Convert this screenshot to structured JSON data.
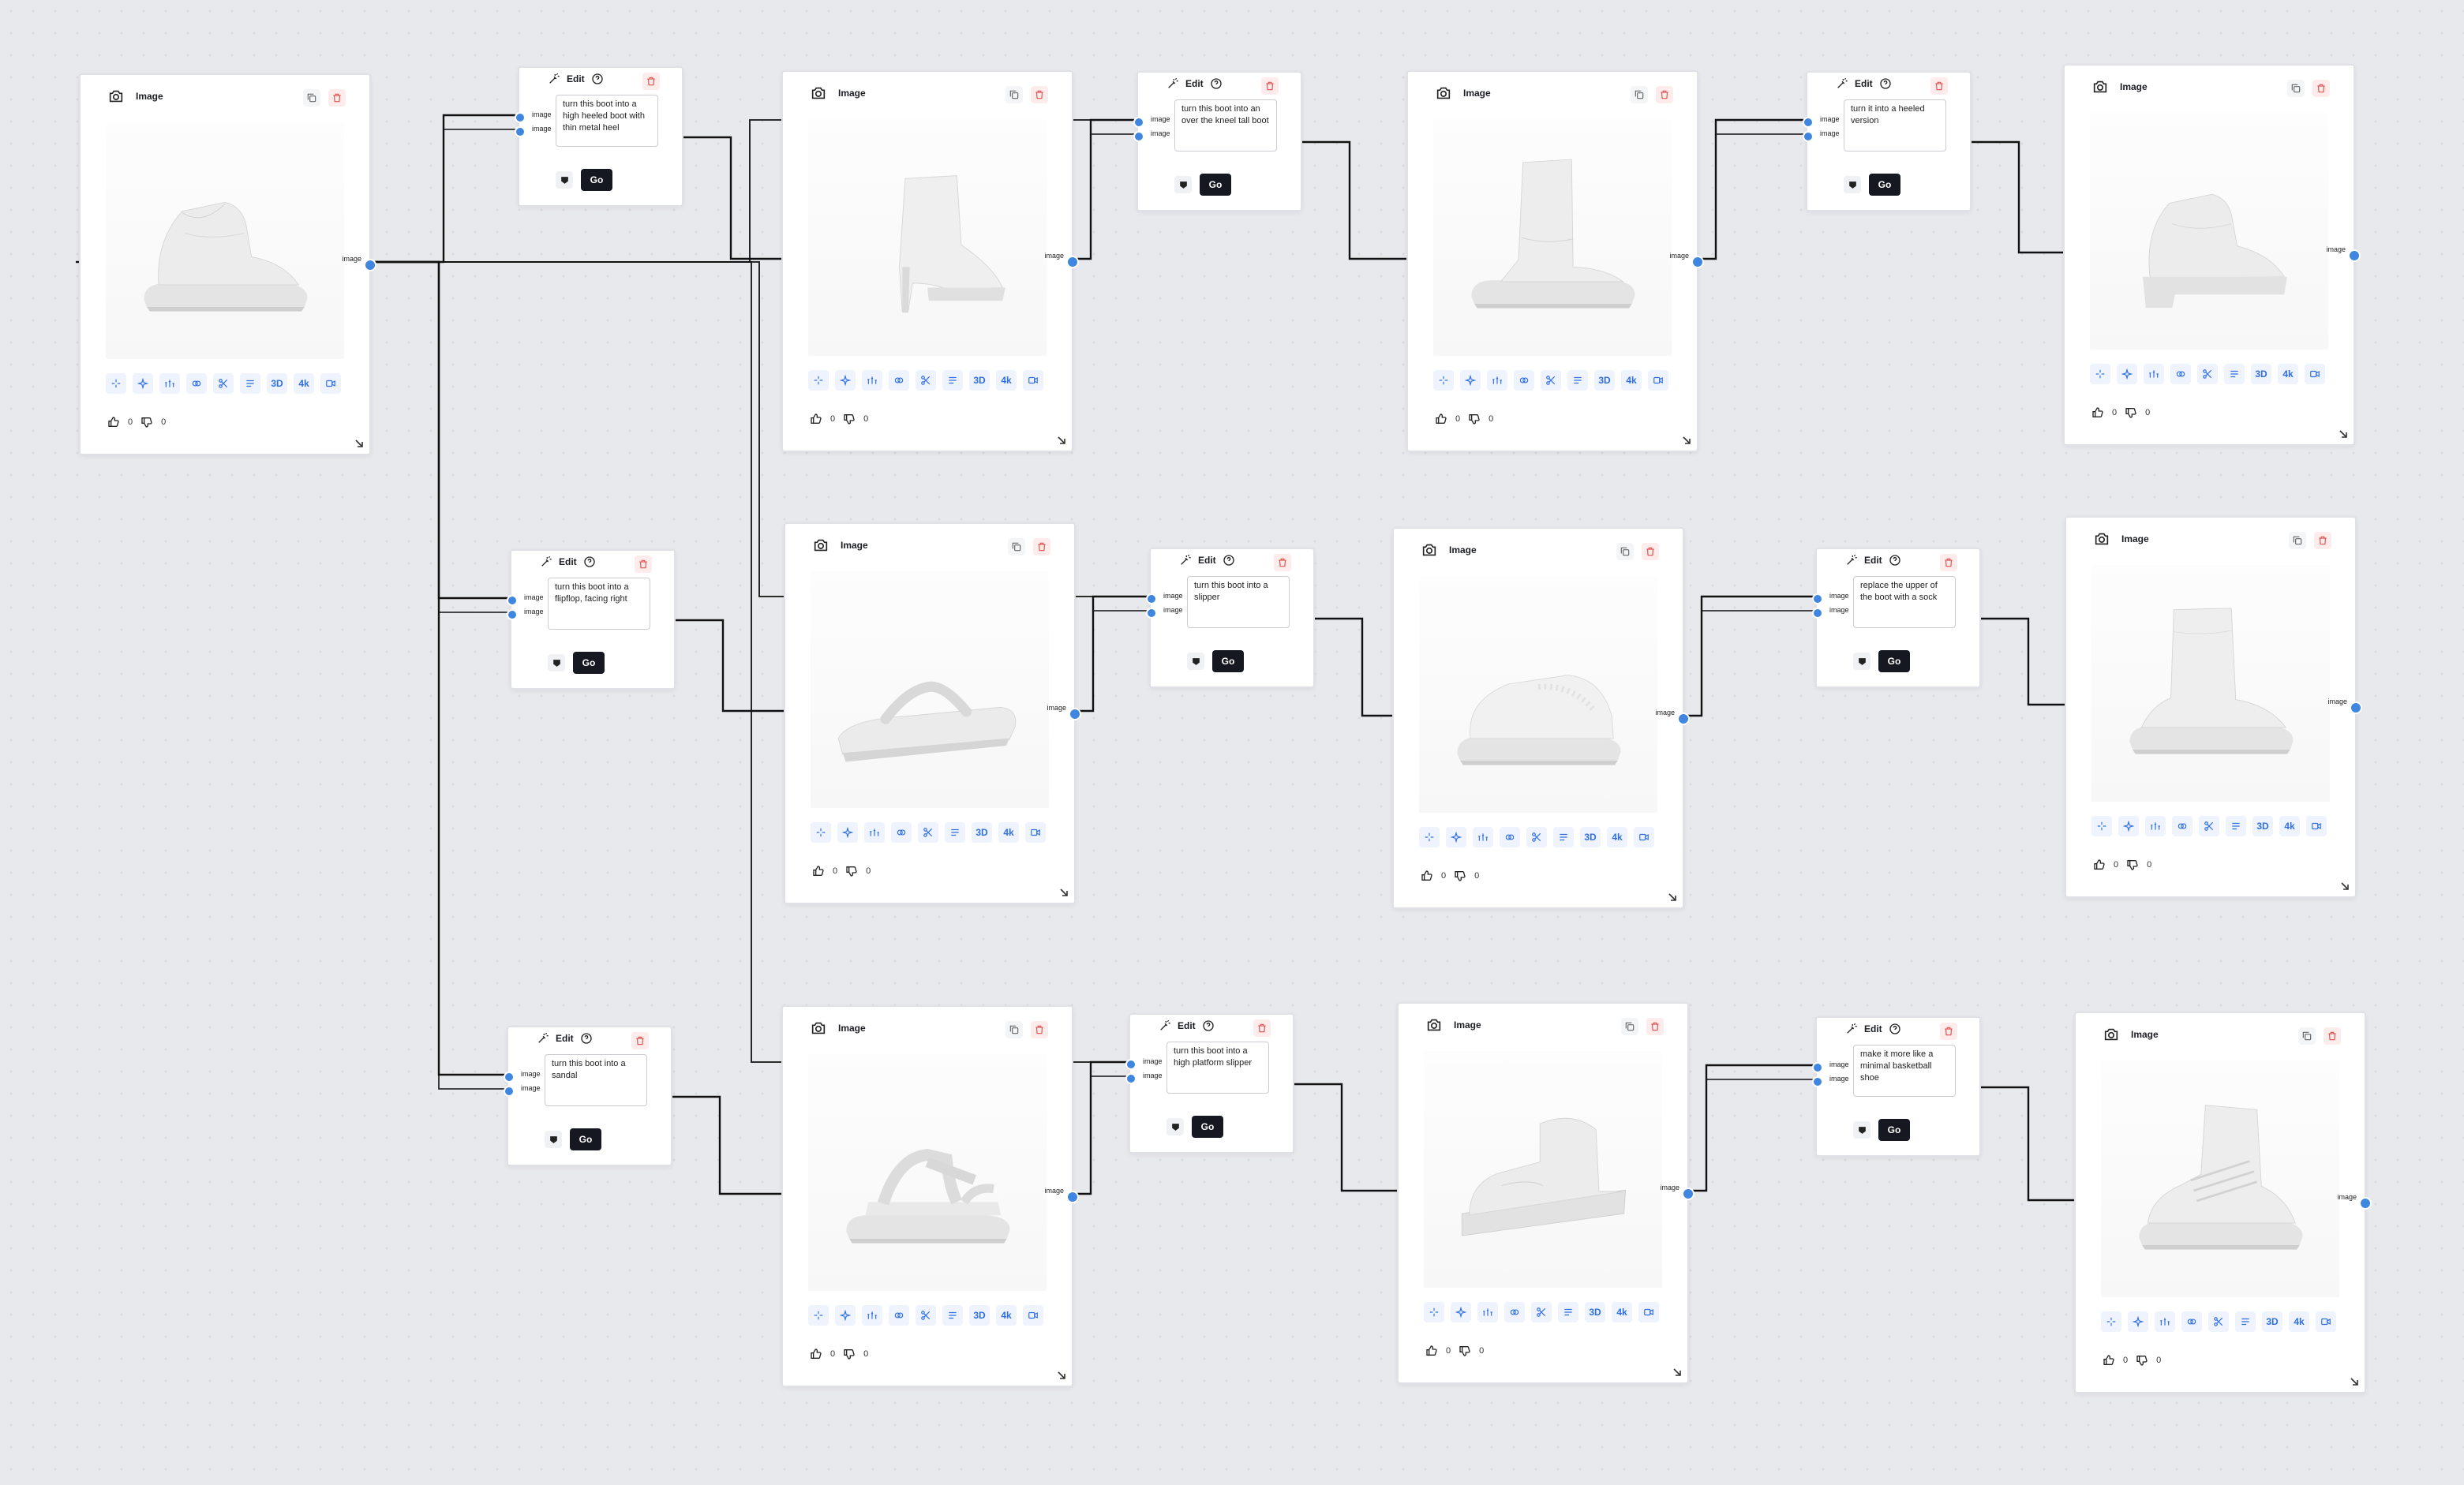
{
  "canvas": {
    "image_title": "Image",
    "edit_title": "Edit",
    "port_label": "image",
    "go_label": "Go",
    "tools": [
      "sparkle-icon",
      "magic-icon",
      "sliders-icon",
      "layers-icon",
      "scissors-icon",
      "text-icon",
      "3D",
      "4k",
      "video-icon"
    ],
    "tool_labels": {
      "3d": "3D",
      "4k": "4k"
    },
    "accent_color": "#3f86e0",
    "go_color": "#151821"
  },
  "image_nodes": [
    {
      "id": "src",
      "likes": "0",
      "dislikes": "0",
      "shoe": "slouch-bootie"
    },
    {
      "id": "r1a",
      "likes": "0",
      "dislikes": "0",
      "shoe": "heeled-bootie"
    },
    {
      "id": "r1b",
      "likes": "0",
      "dislikes": "0",
      "shoe": "tall-boot"
    },
    {
      "id": "r1c",
      "likes": "0",
      "dislikes": "0",
      "shoe": "heeled-slouch"
    },
    {
      "id": "r2a",
      "likes": "0",
      "dislikes": "0",
      "shoe": "flipflop"
    },
    {
      "id": "r2b",
      "likes": "0",
      "dislikes": "0",
      "shoe": "slipper"
    },
    {
      "id": "r2c",
      "likes": "0",
      "dislikes": "0",
      "shoe": "sock-boot"
    },
    {
      "id": "r3a",
      "likes": "0",
      "dislikes": "0",
      "shoe": "sandal"
    },
    {
      "id": "r3b",
      "likes": "0",
      "dislikes": "0",
      "shoe": "platform-slipper"
    },
    {
      "id": "r3c",
      "likes": "0",
      "dislikes": "0",
      "shoe": "basketball-shoe"
    }
  ],
  "edit_nodes": [
    {
      "id": "e1a",
      "prompt": "turn this boot into a high heeled boot with thin metal heel"
    },
    {
      "id": "e1b",
      "prompt": "turn this boot into an over the kneel tall boot"
    },
    {
      "id": "e1c",
      "prompt": "turn it into a heeled version"
    },
    {
      "id": "e2a",
      "prompt": "turn this boot into a flipflop, facing right"
    },
    {
      "id": "e2b",
      "prompt": "turn this boot into a slipper"
    },
    {
      "id": "e2c",
      "prompt": "replace the upper of the boot with a sock"
    },
    {
      "id": "e3a",
      "prompt": "turn this boot into a sandal"
    },
    {
      "id": "e3b",
      "prompt": "turn this boot into a high platform slipper"
    },
    {
      "id": "e3c",
      "prompt": "make it more like a minimal basketball shoe"
    }
  ]
}
